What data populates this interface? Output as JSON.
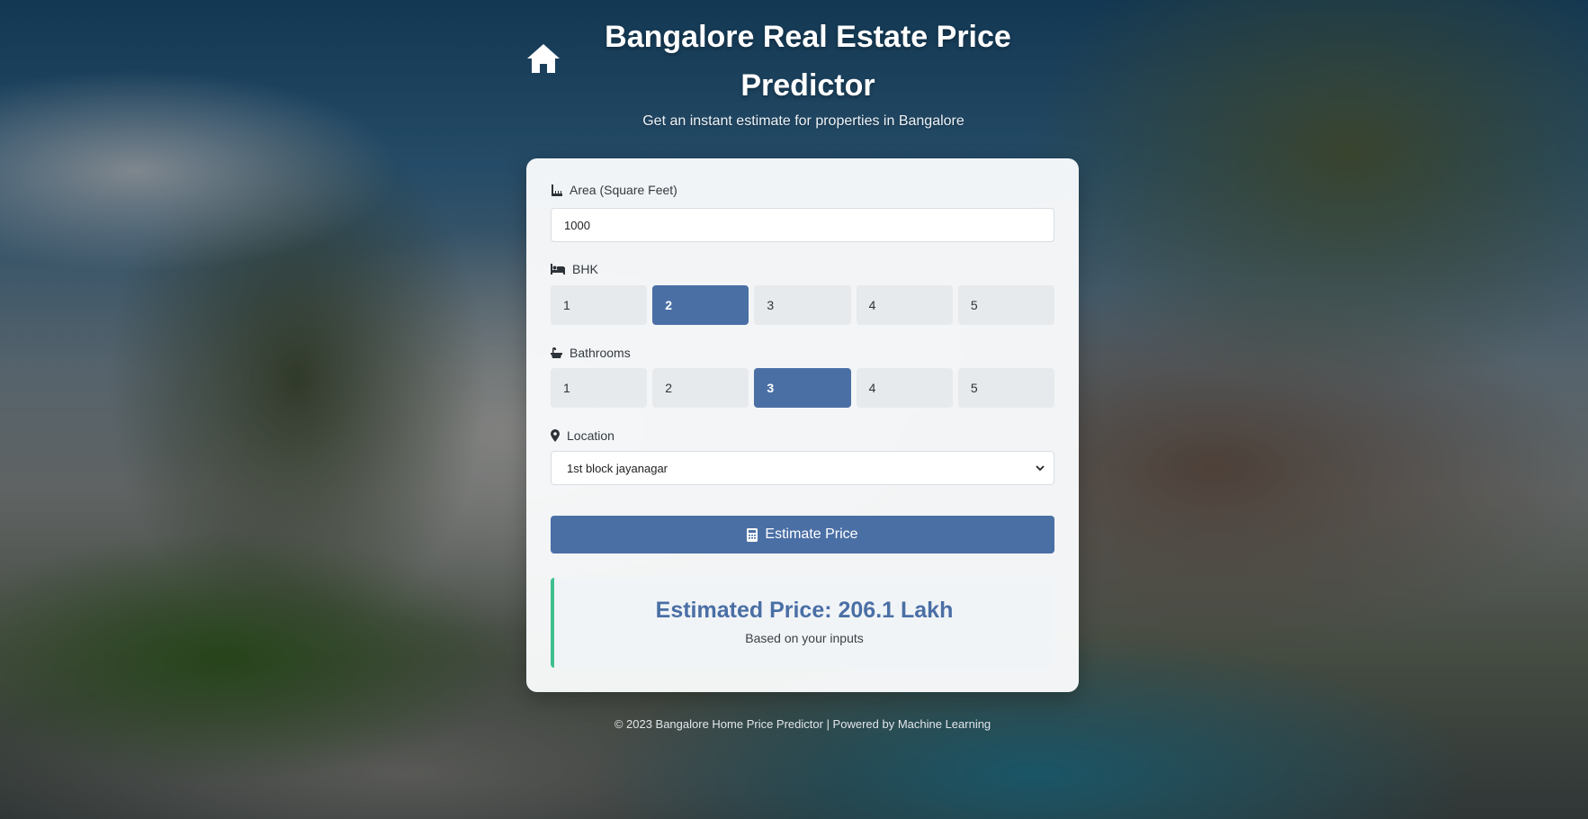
{
  "header": {
    "title": "Bangalore Real Estate Price Predictor",
    "subtitle": "Get an instant estimate for properties in Bangalore",
    "icon": "home-icon"
  },
  "form": {
    "area": {
      "label": "Area (Square Feet)",
      "value": "1000",
      "icon": "ruler-icon"
    },
    "bhk": {
      "label": "BHK",
      "icon": "bed-icon",
      "options": [
        "1",
        "2",
        "3",
        "4",
        "5"
      ],
      "selected": "2"
    },
    "bathrooms": {
      "label": "Bathrooms",
      "icon": "bath-icon",
      "options": [
        "1",
        "2",
        "3",
        "4",
        "5"
      ],
      "selected": "3"
    },
    "location": {
      "label": "Location",
      "icon": "map-pin-icon",
      "selected": "1st block jayanagar"
    },
    "submit_label": "Estimate Price",
    "submit_icon": "calculator-icon"
  },
  "result": {
    "price": "Estimated Price: 206.1 Lakh",
    "note": "Based on your inputs"
  },
  "footer": {
    "text": "© 2023 Bangalore Home Price Predictor | Powered by Machine Learning"
  },
  "colors": {
    "accent": "#4a6fa5",
    "result_border": "#3fbf8f"
  }
}
